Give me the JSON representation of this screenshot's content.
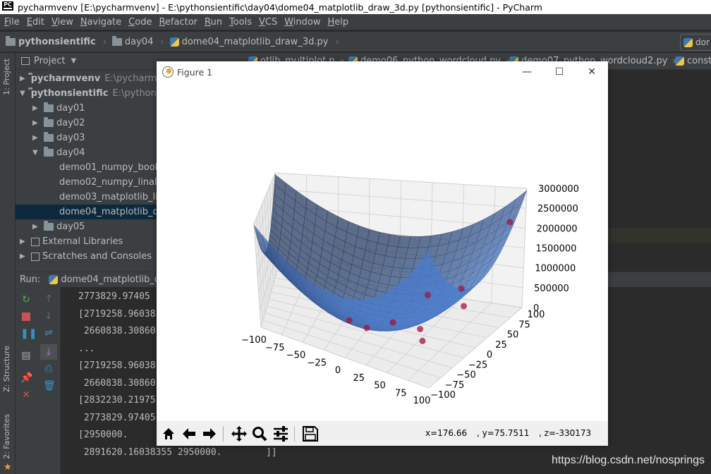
{
  "window": {
    "title": "pycharmvenv [E:\\pycharmvenv] - E:\\pythonsientific\\day04\\dome04_matplotlib_draw_3d.py [pythonsientific] - PyCharm",
    "logo_text": "PC"
  },
  "menu": [
    "File",
    "Edit",
    "View",
    "Navigate",
    "Code",
    "Refactor",
    "Run",
    "Tools",
    "VCS",
    "Window",
    "Help"
  ],
  "breadcrumb": [
    "pythonsientific",
    "day04",
    "dome04_matplotlib_draw_3d.py"
  ],
  "navbar_right": "dor",
  "side_tabs": {
    "project": "1: Project",
    "structure": "Z: Structure",
    "favorites": "2: Favorites"
  },
  "project_panel": {
    "title": "Project",
    "tree": [
      {
        "label": "pycharmvenv",
        "path": "E:\\pycharmvenv",
        "type": "root",
        "expanded": false
      },
      {
        "label": "pythonsientific",
        "path": "E:\\pythons",
        "type": "root",
        "expanded": true
      },
      {
        "label": "day01",
        "type": "folder",
        "expanded": false
      },
      {
        "label": "day02",
        "type": "folder",
        "expanded": false
      },
      {
        "label": "day03",
        "type": "folder",
        "expanded": false
      },
      {
        "label": "day04",
        "type": "folder",
        "expanded": true
      },
      {
        "label": "demo01_numpy_bool",
        "type": "file"
      },
      {
        "label": "demo02_numpy_linalg",
        "type": "file"
      },
      {
        "label": "demo03_matplotlib_li",
        "type": "file"
      },
      {
        "label": "dome04_matplotlib_d",
        "type": "file",
        "selected": true
      },
      {
        "label": "day05",
        "type": "folder",
        "expanded": false
      },
      {
        "label": "External Libraries",
        "type": "lib",
        "expanded": false
      },
      {
        "label": "Scratches and Consoles",
        "type": "scratch",
        "expanded": false
      }
    ]
  },
  "editor_tabs": [
    {
      "label": "otlib_multiplot.p"
    },
    {
      "label": "demo06_python_wordcloud.py"
    },
    {
      "label": "demo07_python_wordcloud2.py"
    },
    {
      "label": "consti"
    }
  ],
  "run_panel": {
    "label": "Run:",
    "config": "dome04_matplotlib_dra"
  },
  "console": [
    "2773829.97405",
    "[2719258.96038",
    " 2660838.30860",
    "...",
    "[2719258.96038",
    " 2660838.30860",
    "[2832230.21975",
    " 2773829.97405",
    "[2950000.",
    " 2891620.16038355 2950000.        ]]"
  ],
  "figure": {
    "title": "Figure 1",
    "coords": {
      "x": "x=176.66",
      "y": ", y=75.7511",
      "z": ", z=-330173"
    },
    "toolbar": [
      "home-icon",
      "back-icon",
      "forward-icon",
      "pan-icon",
      "zoom-icon",
      "configure-icon",
      "save-icon"
    ]
  },
  "chart_data": {
    "type": "surface3d",
    "title": "",
    "surface": "z = 95*(x^2 + y^2) roughly, bowl shape",
    "x_ticks": [
      "−100",
      "−75",
      "−50",
      "−25",
      "0",
      "25",
      "50",
      "75",
      "100"
    ],
    "y_ticks": [
      "−100",
      "−75",
      "−50",
      "−25",
      "0",
      "25",
      "50",
      "75",
      "100"
    ],
    "z_ticks": [
      "0",
      "500000",
      "1000000",
      "1500000",
      "2000000",
      "2500000",
      "3000000"
    ],
    "xlim": [
      -100,
      100
    ],
    "ylim": [
      -100,
      100
    ],
    "zlim": [
      0,
      3000000
    ],
    "surface_color": "#1f77b4",
    "scatter_color": "#a0143c",
    "scatter_points": [
      {
        "x": 95,
        "y": 80,
        "z": 2300000
      },
      {
        "x": 70,
        "y": 40,
        "z": 900000
      },
      {
        "x": 80,
        "y": 20,
        "z": 700000
      },
      {
        "x": 40,
        "y": 40,
        "z": 600000
      },
      {
        "x": 50,
        "y": -10,
        "z": 250000
      },
      {
        "x": 60,
        "y": -30,
        "z": 200000
      },
      {
        "x": 20,
        "y": 0,
        "z": 150000
      },
      {
        "x": 0,
        "y": -20,
        "z": 60000
      },
      {
        "x": -20,
        "y": -10,
        "z": 40000
      }
    ]
  },
  "watermark": "https://blog.csdn.net/nosprings"
}
